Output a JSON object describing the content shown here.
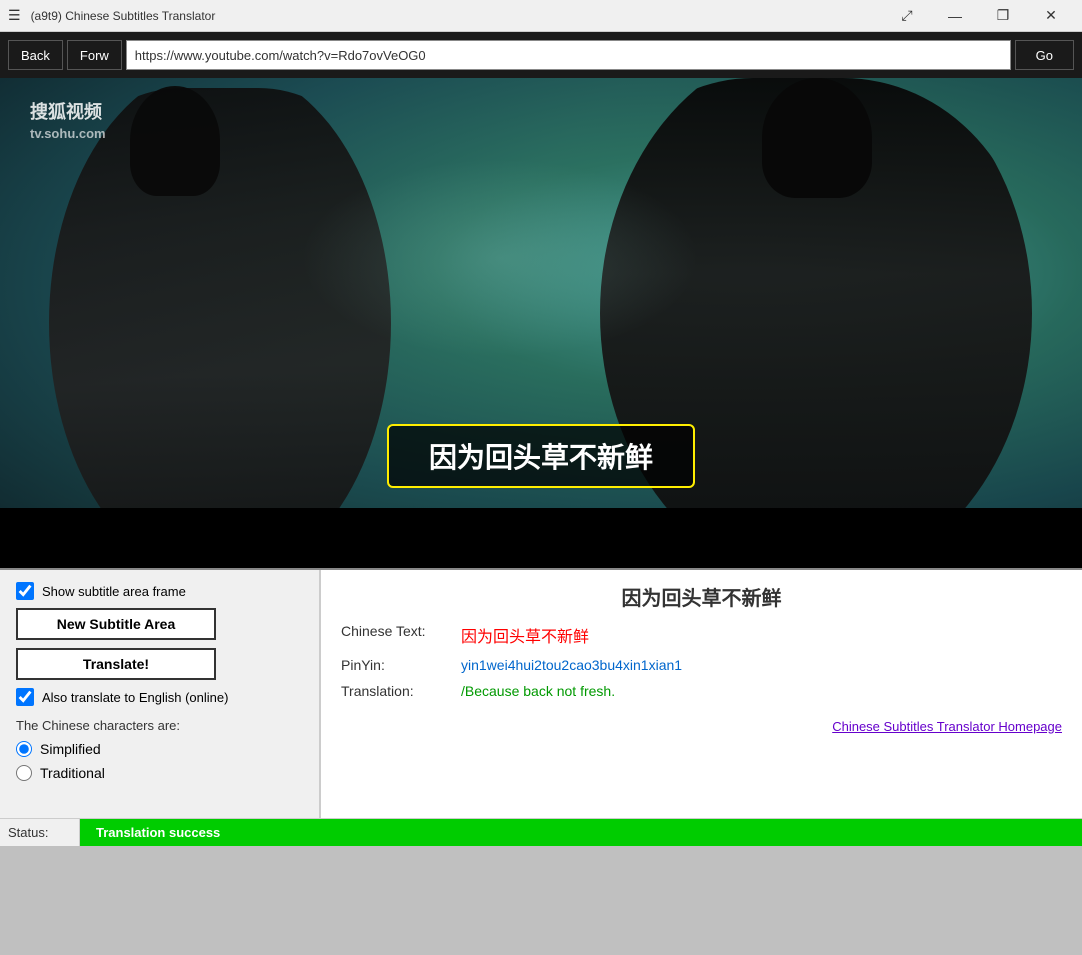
{
  "titlebar": {
    "menu_icon": "☰",
    "title": "(a9t9) Chinese Subtitles Translator",
    "minimize": "—",
    "restore": "❐",
    "close": "✕"
  },
  "navbar": {
    "back_label": "Back",
    "forward_label": "Forw",
    "url": "https://www.youtube.com/watch?v=Rdo7ovVeOG0",
    "go_label": "Go"
  },
  "video": {
    "watermark_line1": "搜狐视频",
    "watermark_line2": "tv.sohu.com",
    "subtitle_text": "因为回头草不新鲜"
  },
  "controls": {
    "show_subtitle_frame_label": "Show subtitle area frame",
    "new_subtitle_area_label": "New Subtitle Area",
    "translate_label": "Translate!",
    "also_translate_label": "Also translate to English (online)",
    "chinese_chars_label": "The Chinese characters are:",
    "simplified_label": "Simplified",
    "traditional_label": "Traditional"
  },
  "translation": {
    "title": "因为回头草不新鲜",
    "chinese_text_label": "Chinese Text:",
    "chinese_text_value": "因为回头草不新鲜",
    "pinyin_label": "PinYin:",
    "pinyin_value": "yin1wei4hui2tou2cao3bu4xin1xian1",
    "translation_label": "Translation:",
    "translation_value": "/Because back not fresh.",
    "homepage_link": "Chinese Subtitles Translator Homepage"
  },
  "statusbar": {
    "status_label": "Status:",
    "status_value": "Translation success"
  }
}
